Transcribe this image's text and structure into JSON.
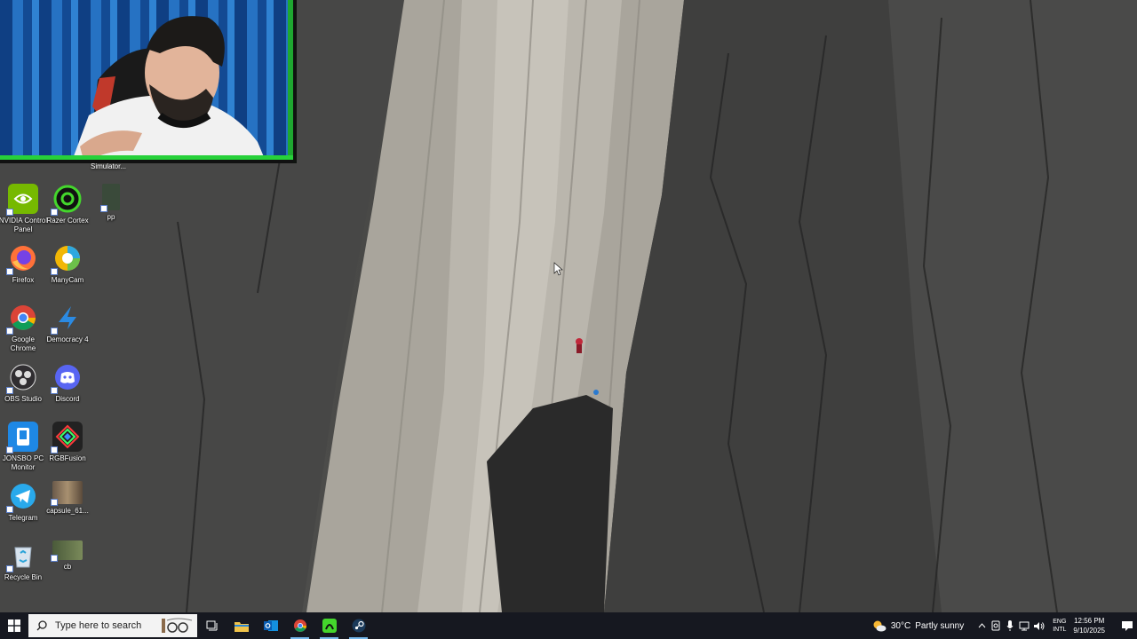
{
  "desktop": {
    "top_label": "Simulator...",
    "icons": [
      {
        "name": "nvidia-control-panel",
        "label": "NVIDIA Control Panel",
        "color": "#76b900"
      },
      {
        "name": "razer-cortex",
        "label": "Razer Cortex",
        "color": "#44d62c"
      },
      {
        "name": "pp",
        "label": "pp",
        "color": "#3a4a3a"
      },
      {
        "name": "firefox",
        "label": "Firefox",
        "color": "#ff7139"
      },
      {
        "name": "manycam",
        "label": "ManyCam",
        "color": "#2ea8e0"
      },
      {
        "name": "google-chrome",
        "label": "Google Chrome",
        "color": "#1a73e8"
      },
      {
        "name": "democracy-4",
        "label": "Democracy 4",
        "color": "#2b8ae2"
      },
      {
        "name": "obs-studio",
        "label": "OBS Studio",
        "color": "#302e31"
      },
      {
        "name": "discord",
        "label": "Discord",
        "color": "#5865f2"
      },
      {
        "name": "jonsbo-pc-monitor",
        "label": "JONSBO PC Monitor",
        "color": "#1e88e5"
      },
      {
        "name": "rgb-fusion",
        "label": "RGBFusion",
        "color": "#222222"
      },
      {
        "name": "telegram",
        "label": "Telegram",
        "color": "#29a9eb"
      },
      {
        "name": "capsule",
        "label": "capsule_61...",
        "color": "#6b5a4a"
      },
      {
        "name": "recycle-bin",
        "label": "Recycle Bin",
        "color": "#d8e4ef"
      },
      {
        "name": "cb",
        "label": "cb",
        "color": "#4a5a3a"
      }
    ]
  },
  "taskbar": {
    "search_placeholder": "Type here to search",
    "apps": [
      "task-view-icon",
      "file-explorer-icon",
      "outlook-icon",
      "chrome-icon",
      "razer-icon",
      "steam-icon"
    ],
    "weather": {
      "temp": "30°C",
      "desc": "Partly sunny"
    },
    "language": {
      "top": "ENG",
      "bottom": "INTL"
    },
    "time": "12:56 PM",
    "date": "9/10/2025"
  }
}
